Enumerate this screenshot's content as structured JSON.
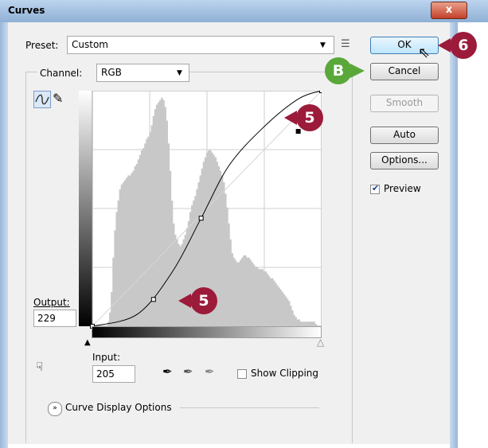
{
  "window": {
    "title": "Curves",
    "close_symbol": "x"
  },
  "preset": {
    "label": "Preset:",
    "value": "Custom"
  },
  "channel": {
    "label": "Channel:",
    "value": "RGB"
  },
  "buttons": {
    "ok": "OK",
    "cancel": "Cancel",
    "smooth": "Smooth",
    "auto": "Auto",
    "options": "Options..."
  },
  "preview": {
    "label": "Preview",
    "checked": true
  },
  "output": {
    "label": "Output:",
    "value": "229"
  },
  "input": {
    "label": "Input:",
    "value": "205"
  },
  "show_clipping": {
    "label": "Show Clipping",
    "checked": false
  },
  "curve_display_options": "Curve Display Options",
  "callouts": {
    "ok_step": "6",
    "cancel_step": "B",
    "upper_point_step": "5",
    "lower_point_step": "5"
  },
  "curve": {
    "range": [
      0,
      255
    ],
    "points": [
      [
        0,
        0
      ],
      [
        50,
        13
      ],
      [
        89,
        59
      ],
      [
        121,
        117
      ],
      [
        152,
        174
      ],
      [
        191,
        216
      ],
      [
        229,
        246
      ],
      [
        255,
        255
      ]
    ],
    "control_points": [
      [
        0,
        0
      ],
      [
        68,
        29
      ],
      [
        121,
        117
      ],
      [
        229,
        211
      ],
      [
        255,
        255
      ]
    ],
    "selected_point": [
      229,
      211
    ]
  },
  "histogram_heights": [
    0.0,
    0.0,
    0.0,
    0.0,
    0.0,
    0.0,
    0.0,
    0.0,
    0.0,
    0.02,
    0.06,
    0.15,
    0.3,
    0.42,
    0.5,
    0.55,
    0.6,
    0.62,
    0.63,
    0.64,
    0.65,
    0.66,
    0.66,
    0.67,
    0.68,
    0.7,
    0.71,
    0.73,
    0.75,
    0.77,
    0.78,
    0.8,
    0.82,
    0.83,
    0.85,
    0.88,
    0.92,
    0.95,
    0.97,
    0.98,
    0.99,
    1.0,
    0.99,
    0.96,
    0.9,
    0.8,
    0.68,
    0.55,
    0.45,
    0.4,
    0.38,
    0.36,
    0.35,
    0.36,
    0.38,
    0.4,
    0.43,
    0.46,
    0.5,
    0.53,
    0.55,
    0.57,
    0.6,
    0.63,
    0.66,
    0.69,
    0.72,
    0.74,
    0.76,
    0.77,
    0.77,
    0.76,
    0.75,
    0.74,
    0.72,
    0.7,
    0.68,
    0.66,
    0.63,
    0.58,
    0.52,
    0.45,
    0.38,
    0.32,
    0.3,
    0.29,
    0.28,
    0.28,
    0.29,
    0.3,
    0.31,
    0.31,
    0.3,
    0.3,
    0.29,
    0.28,
    0.27,
    0.26,
    0.26,
    0.25,
    0.25,
    0.25,
    0.24,
    0.24,
    0.23,
    0.22,
    0.21,
    0.21,
    0.2,
    0.19,
    0.18,
    0.17,
    0.16,
    0.15,
    0.14,
    0.13,
    0.12,
    0.11,
    0.09,
    0.07,
    0.05,
    0.04,
    0.03,
    0.03,
    0.02,
    0.02,
    0.02,
    0.02,
    0.02,
    0.02,
    0.02,
    0.02,
    0.02,
    0.01,
    0.0,
    0.0,
    0.0
  ],
  "colors": {
    "badge": "#9c1b3a",
    "badge_b": "#5aa83a",
    "histogram": "#c8c8c8",
    "curve": "#000000",
    "grid": "#cfcfcf"
  }
}
